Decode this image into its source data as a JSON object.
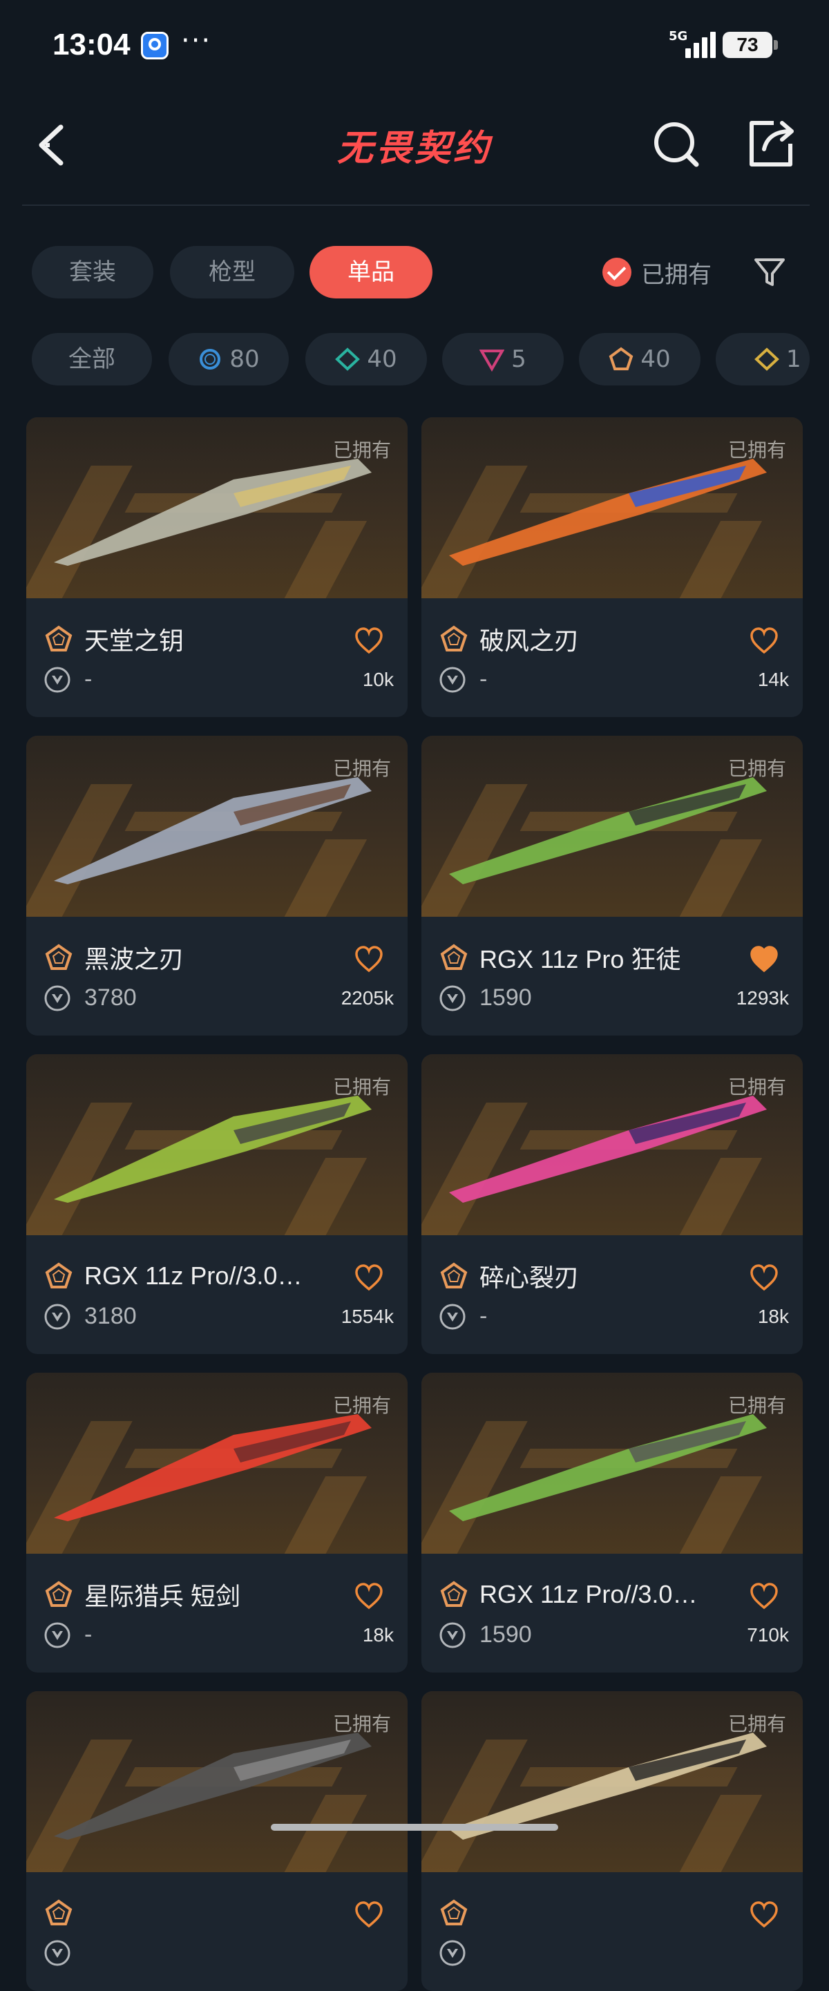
{
  "status": {
    "time": "13:04",
    "network": "5G",
    "battery": "73"
  },
  "header": {
    "title": "无畏契约"
  },
  "tabs": [
    {
      "label": "套装",
      "active": false
    },
    {
      "label": "枪型",
      "active": false
    },
    {
      "label": "单品",
      "active": true
    }
  ],
  "owned_filter": {
    "label": "已拥有",
    "checked": true
  },
  "chips": [
    {
      "label": "全部",
      "icon": "all"
    },
    {
      "label": "80",
      "icon": "tier-blue-circle",
      "color": "#3a8fd8"
    },
    {
      "label": "40",
      "icon": "tier-teal-diamond",
      "color": "#2ab3a0"
    },
    {
      "label": "5",
      "icon": "tier-pink-triangle",
      "color": "#d0407a"
    },
    {
      "label": "40",
      "icon": "tier-orange-pentagon",
      "color": "#e89a5a"
    },
    {
      "label": "1",
      "icon": "tier-yellow-diamond",
      "color": "#d8b040"
    }
  ],
  "cards": [
    {
      "name": "天堂之钥",
      "owned": "已拥有",
      "price": "-",
      "likes": "10k",
      "liked": false
    },
    {
      "name": "破风之刃",
      "owned": "已拥有",
      "price": "-",
      "likes": "14k",
      "liked": false
    },
    {
      "name": "黑波之刃",
      "owned": "已拥有",
      "price": "3780",
      "likes": "2205k",
      "liked": false
    },
    {
      "name": "RGX 11z Pro 狂徒",
      "owned": "已拥有",
      "price": "1590",
      "likes": "1293k",
      "liked": true
    },
    {
      "name": "RGX 11z Pro//3.0…",
      "owned": "已拥有",
      "price": "3180",
      "likes": "1554k",
      "liked": false
    },
    {
      "name": "碎心裂刃",
      "owned": "已拥有",
      "price": "-",
      "likes": "18k",
      "liked": false
    },
    {
      "name": "星际猎兵 短剑",
      "owned": "已拥有",
      "price": "-",
      "likes": "18k",
      "liked": false
    },
    {
      "name": "RGX 11z Pro//3.0…",
      "owned": "已拥有",
      "price": "1590",
      "likes": "710k",
      "liked": false
    },
    {
      "name": "",
      "owned": "已拥有",
      "price": "",
      "likes": "",
      "liked": false
    },
    {
      "name": "",
      "owned": "已拥有",
      "price": "",
      "likes": "",
      "liked": false
    }
  ]
}
